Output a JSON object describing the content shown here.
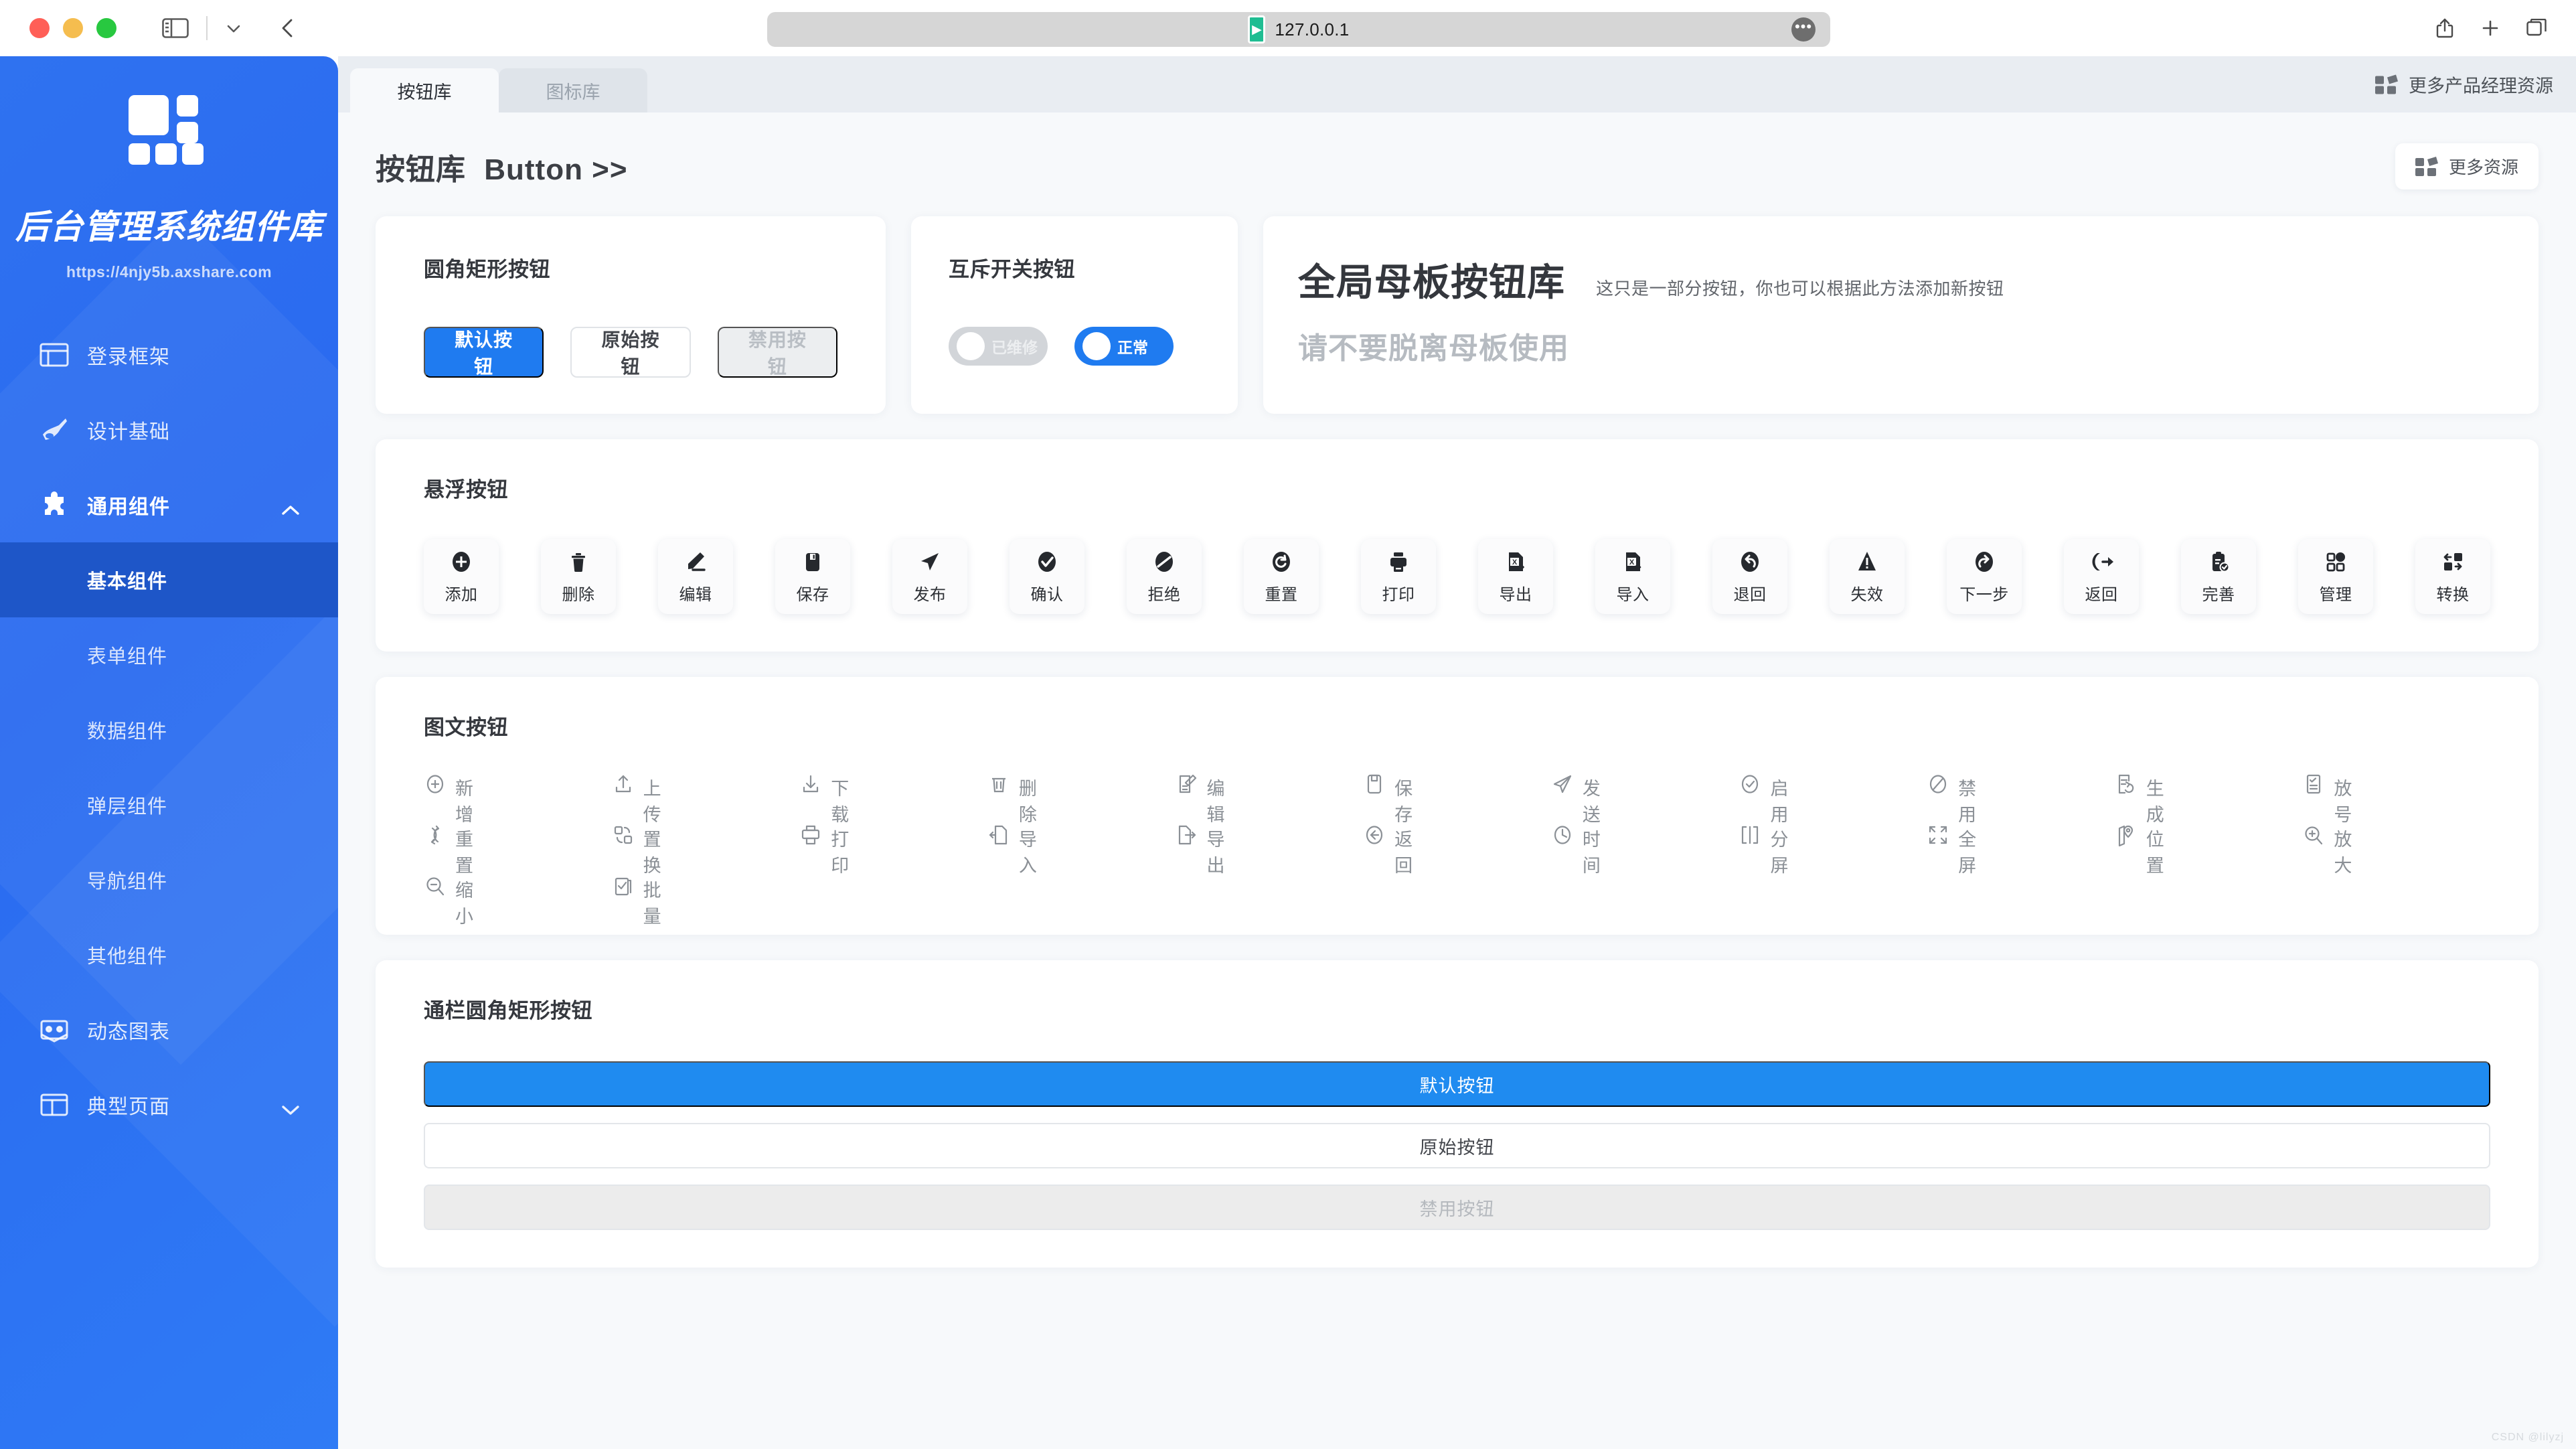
{
  "browser": {
    "url": "127.0.0.1",
    "shield_icon": "play-shield-icon",
    "more_icon": "ellipsis-icon",
    "sidebar_toggle_icon": "sidebar-toggle-icon",
    "chevron_icon": "chevron-down-icon",
    "back_icon": "back-chevron-icon",
    "share_icon": "share-icon",
    "new_tab_icon": "plus-icon",
    "tabs_icon": "tab-overview-icon"
  },
  "sidebar": {
    "logo_icon": "grid-blocks-logo",
    "title": "后台管理系统组件库",
    "url": "https://4njy5b.axshare.com",
    "items": [
      {
        "label": "登录框架",
        "icon": "login-frame-icon",
        "type": "top"
      },
      {
        "label": "设计基础",
        "icon": "design-brush-icon",
        "type": "top"
      },
      {
        "label": "通用组件",
        "icon": "puzzle-icon",
        "type": "top",
        "expanded": true,
        "chevron": "chevron-up-icon"
      },
      {
        "label": "基本组件",
        "type": "sub",
        "selected": true
      },
      {
        "label": "表单组件",
        "type": "sub"
      },
      {
        "label": "数据组件",
        "type": "sub"
      },
      {
        "label": "弹层组件",
        "type": "sub"
      },
      {
        "label": "导航组件",
        "type": "sub"
      },
      {
        "label": "其他组件",
        "type": "sub"
      },
      {
        "label": "动态图表",
        "icon": "chart-icon",
        "type": "top"
      },
      {
        "label": "典型页面",
        "icon": "page-layout-icon",
        "type": "top",
        "chevron": "chevron-down-icon"
      }
    ]
  },
  "tabbar": {
    "tabs": [
      {
        "label": "按钮库",
        "active": true
      },
      {
        "label": "图标库",
        "active": false
      }
    ],
    "more_resources": "更多产品经理资源",
    "more_resources_icon": "grid-squares-icon"
  },
  "page": {
    "title_cn": "按钮库",
    "title_en": "Button >>",
    "more_button": "更多资源",
    "more_button_icon": "grid-squares-icon"
  },
  "cards": {
    "rounded": {
      "title": "圆角矩形按钮",
      "buttons": [
        {
          "label": "默认按钮",
          "style": "primary"
        },
        {
          "label": "原始按钮",
          "style": "default"
        },
        {
          "label": "禁用按钮",
          "style": "disabled"
        }
      ]
    },
    "toggle": {
      "title": "互斥开关按钮",
      "switches": [
        {
          "label": "已维修",
          "state": "off"
        },
        {
          "label": "正常",
          "state": "on"
        }
      ]
    },
    "master": {
      "title": "全局母板按钮库",
      "note": "这只是一部分按钮，你也可以根据此方法添加新按钮",
      "subtitle": "请不要脱离母板使用"
    }
  },
  "floating_section": {
    "title": "悬浮按钮",
    "buttons": [
      {
        "label": "添加",
        "icon": "plus-circle-icon"
      },
      {
        "label": "删除",
        "icon": "trash-icon"
      },
      {
        "label": "编辑",
        "icon": "pencil-icon"
      },
      {
        "label": "保存",
        "icon": "floppy-icon"
      },
      {
        "label": "发布",
        "icon": "paper-plane-icon"
      },
      {
        "label": "确认",
        "icon": "check-circle-icon"
      },
      {
        "label": "拒绝",
        "icon": "ban-circle-icon"
      },
      {
        "label": "重置",
        "icon": "reset-circle-icon"
      },
      {
        "label": "打印",
        "icon": "printer-icon"
      },
      {
        "label": "导出",
        "icon": "file-export-icon"
      },
      {
        "label": "导入",
        "icon": "file-import-icon"
      },
      {
        "label": "退回",
        "icon": "undo-circle-icon"
      },
      {
        "label": "失效",
        "icon": "warning-triangle-icon"
      },
      {
        "label": "下一步",
        "icon": "redo-circle-icon"
      },
      {
        "label": "返回",
        "icon": "logout-icon"
      },
      {
        "label": "完善",
        "icon": "clipboard-check-icon"
      },
      {
        "label": "管理",
        "icon": "grid-dots-icon"
      },
      {
        "label": "转换",
        "icon": "swap-blocks-icon"
      }
    ]
  },
  "text_section": {
    "title": "图文按钮",
    "buttons": [
      {
        "label": "新增",
        "icon": "plus-circle-outline-icon"
      },
      {
        "label": "上传",
        "icon": "upload-icon"
      },
      {
        "label": "下载",
        "icon": "download-icon"
      },
      {
        "label": "删除",
        "icon": "trash-outline-icon"
      },
      {
        "label": "编辑",
        "icon": "edit-doc-icon"
      },
      {
        "label": "保存",
        "icon": "floppy-outline-icon"
      },
      {
        "label": "发送",
        "icon": "send-outline-icon"
      },
      {
        "label": "启用",
        "icon": "check-circle-outline-icon"
      },
      {
        "label": "禁用",
        "icon": "ban-circle-outline-icon"
      },
      {
        "label": "生成",
        "icon": "generate-doc-icon"
      },
      {
        "label": "放号",
        "icon": "checklist-icon"
      },
      {
        "label": "重置",
        "icon": "refresh-outline-icon"
      },
      {
        "label": "置换",
        "icon": "replace-icon"
      },
      {
        "label": "打印",
        "icon": "printer-outline-icon"
      },
      {
        "label": "导入",
        "icon": "file-in-icon"
      },
      {
        "label": "导出",
        "icon": "file-out-icon"
      },
      {
        "label": "返回",
        "icon": "back-circle-icon"
      },
      {
        "label": "时间",
        "icon": "clock-icon"
      },
      {
        "label": "分屏",
        "icon": "split-screen-icon"
      },
      {
        "label": "全屏",
        "icon": "fullscreen-icon"
      },
      {
        "label": "位置",
        "icon": "map-pin-icon"
      },
      {
        "label": "放大",
        "icon": "zoom-in-icon"
      },
      {
        "label": "缩小",
        "icon": "zoom-out-icon"
      },
      {
        "label": "批量",
        "icon": "batch-check-icon"
      }
    ]
  },
  "wide_section": {
    "title": "通栏圆角矩形按钮",
    "buttons": [
      {
        "label": "默认按钮",
        "style": "primary"
      },
      {
        "label": "原始按钮",
        "style": "default"
      },
      {
        "label": "禁用按钮",
        "style": "disabled"
      }
    ]
  },
  "watermark": "CSDN @lilyzj",
  "colors": {
    "brand_blue": "#2f72f0",
    "primary_blue": "#1f7bf0",
    "wide_blue": "#1f8bf0",
    "sidebar_selected": "#1e56c8",
    "content_bg": "#f7f9fb",
    "tabbar_bg": "#e9edf2"
  }
}
